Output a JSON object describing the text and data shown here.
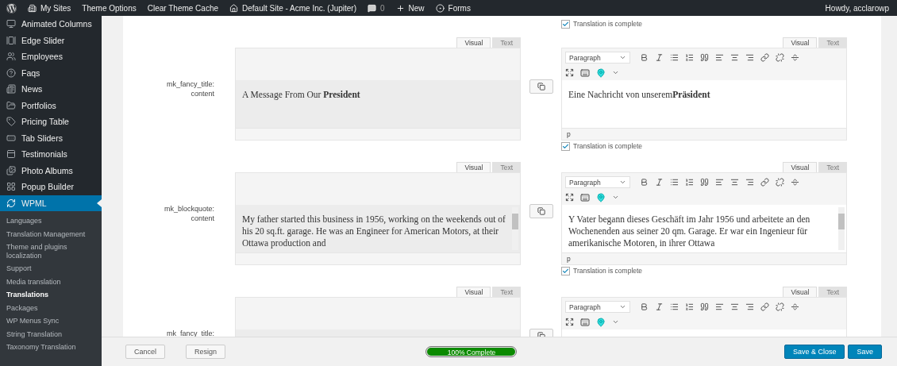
{
  "admin_bar": {
    "items": [
      {
        "kind": "logo"
      },
      {
        "kind": "sites",
        "label": "My Sites"
      },
      {
        "kind": "text",
        "label": "Theme Options"
      },
      {
        "kind": "text",
        "label": "Clear Theme Cache"
      },
      {
        "kind": "home",
        "label": "Default Site - Acme Inc. (Jupiter)"
      },
      {
        "kind": "comments",
        "label": "0"
      },
      {
        "kind": "new",
        "label": "New"
      },
      {
        "kind": "forms",
        "label": "Forms"
      }
    ],
    "greeting": "Howdy, acclarowp"
  },
  "sidebar": {
    "items": [
      {
        "kind": "columns",
        "label": "Animated Columns",
        "selected": false
      },
      {
        "kind": "slider",
        "label": "Edge Slider",
        "selected": false
      },
      {
        "kind": "users",
        "label": "Employees",
        "selected": false
      },
      {
        "kind": "help",
        "label": "Faqs",
        "selected": false
      },
      {
        "kind": "news",
        "label": "News",
        "selected": false
      },
      {
        "kind": "folder",
        "label": "Portfolios",
        "selected": false
      },
      {
        "kind": "tag",
        "label": "Pricing Table",
        "selected": false
      },
      {
        "kind": "tabs",
        "label": "Tab Sliders",
        "selected": false
      },
      {
        "kind": "panel",
        "label": "Testimonials",
        "selected": false
      },
      {
        "kind": "images",
        "label": "Photo Albums",
        "selected": false
      },
      {
        "kind": "grid",
        "label": "Popup Builder",
        "selected": false
      },
      {
        "kind": "wpml",
        "label": "WPML",
        "selected": true
      }
    ],
    "submenu": [
      {
        "label": "Languages",
        "selected": false
      },
      {
        "label": "Translation Management",
        "selected": false
      },
      {
        "label": "Theme and plugins localization",
        "selected": false
      },
      {
        "label": "Support",
        "selected": false
      },
      {
        "label": "Media translation",
        "selected": false
      },
      {
        "label": "Translations",
        "selected": true
      },
      {
        "label": "Packages",
        "selected": false
      },
      {
        "label": "WP Menus Sync",
        "selected": false
      },
      {
        "label": "String Translation",
        "selected": false
      },
      {
        "label": "Taxonomy Translation",
        "selected": false
      }
    ]
  },
  "previous_complete": {
    "label": "Translation is complete",
    "checked": true
  },
  "rows": [
    {
      "kind": "heading",
      "label_lines": [
        "mk_fancy_title:",
        "content"
      ],
      "source": {
        "tabs": [
          {
            "label": "Visual",
            "selected": true
          },
          {
            "label": "Text",
            "selected": false
          }
        ],
        "content": "A Message From Our **President**"
      },
      "target": {
        "tabs": [
          {
            "label": "Visual",
            "selected": true
          },
          {
            "label": "Text",
            "selected": false
          }
        ],
        "format": "Paragraph",
        "content": "Eine Nachricht von unserem**Präsident**",
        "path": "p"
      },
      "complete": {
        "label": "Translation is complete",
        "checked": true
      }
    },
    {
      "kind": "paragraph",
      "label_lines": [
        "mk_blockquote:",
        "content"
      ],
      "source": {
        "tabs": [
          {
            "label": "Visual",
            "selected": true
          },
          {
            "label": "Text",
            "selected": false
          }
        ],
        "content": "My father started this business in 1956, working on the weekends out of his 20 sq.ft. garage. He was an Engineer for American Motors, at their Ottawa production and"
      },
      "target": {
        "tabs": [
          {
            "label": "Visual",
            "selected": true
          },
          {
            "label": "Text",
            "selected": false
          }
        ],
        "format": "Paragraph",
        "content": "Y Vater begann dieses Geschäft im Jahr 1956 und arbeitete an den Wochenenden aus seiner 20 qm. Garage. Er war ein Ingenieur für amerikanische Motoren, in ihrer Ottawa",
        "path": "p"
      },
      "complete": {
        "label": "Translation is complete",
        "checked": true
      }
    },
    {
      "kind": "heading",
      "label_lines": [
        "mk_fancy_title:"
      ],
      "source": {
        "tabs": [
          {
            "label": "Visual",
            "selected": true
          },
          {
            "label": "Text",
            "selected": false
          }
        ]
      },
      "target": {
        "tabs": [
          {
            "label": "Visual",
            "selected": true
          },
          {
            "label": "Text",
            "selected": false
          }
        ],
        "format": "Paragraph"
      }
    }
  ],
  "footer": {
    "left_buttons": [
      "Cancel",
      "Resign"
    ],
    "progress": {
      "label": "100% Complete",
      "level": 1
    },
    "right_buttons": [
      "Save & Close",
      "Save"
    ]
  }
}
